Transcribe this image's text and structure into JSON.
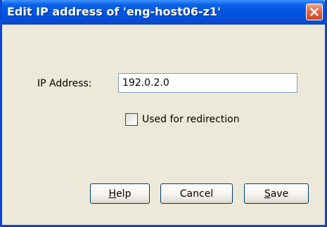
{
  "window": {
    "title": "Edit IP address of 'eng-host06-z1'",
    "close_icon": "close-icon"
  },
  "form": {
    "ip_label": "IP Address:",
    "ip_value": "192.0.2.0",
    "redirect_label": "Used for redirection",
    "redirect_checked": false
  },
  "buttons": {
    "help": {
      "mnemonic": "H",
      "rest": "elp"
    },
    "cancel": {
      "label": "Cancel"
    },
    "save": {
      "mnemonic": "S",
      "rest": "ave"
    }
  },
  "colors": {
    "titlebar": "#0356e0",
    "window_bg": "#ece9d8",
    "close_button": "#d2441f"
  }
}
